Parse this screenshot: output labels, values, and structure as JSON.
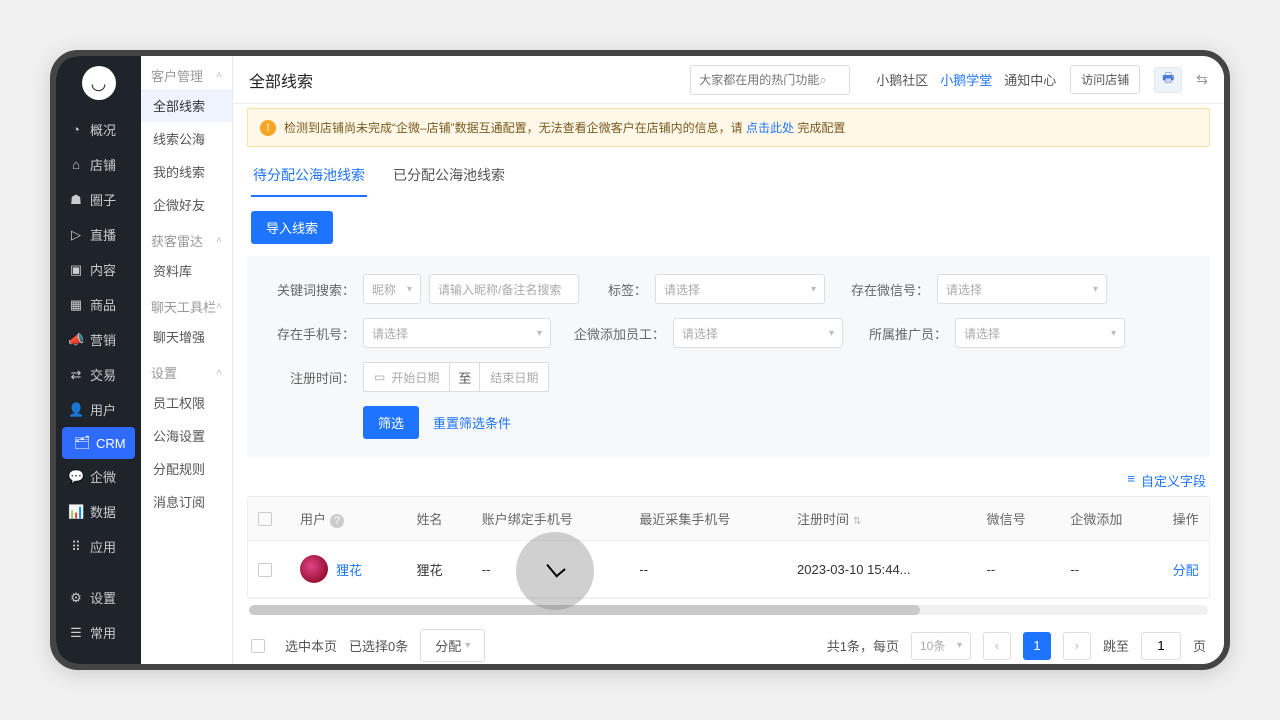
{
  "nav": {
    "items": [
      {
        "icon": "◔",
        "label": "概况"
      },
      {
        "icon": "⌂",
        "label": "店铺"
      },
      {
        "icon": "☗",
        "label": "圈子"
      },
      {
        "icon": "▷",
        "label": "直播"
      },
      {
        "icon": "▣",
        "label": "内容"
      },
      {
        "icon": "▦",
        "label": "商品"
      },
      {
        "icon": "📣",
        "label": "营销"
      },
      {
        "icon": "⇄",
        "label": "交易"
      },
      {
        "icon": "👤",
        "label": "用户"
      },
      {
        "icon": "🗂",
        "label": "CRM"
      },
      {
        "icon": "💬",
        "label": "企微"
      },
      {
        "icon": "📊",
        "label": "数据"
      },
      {
        "icon": "⠿",
        "label": "应用"
      }
    ],
    "footer": [
      {
        "icon": "⚙",
        "label": "设置"
      },
      {
        "icon": "☰",
        "label": "常用"
      }
    ]
  },
  "sec": {
    "groups": [
      {
        "title": "客户管理",
        "items": [
          "全部线索",
          "线索公海",
          "我的线索",
          "企微好友"
        ],
        "active": 0
      },
      {
        "title": "获客雷达",
        "items": [
          "资料库"
        ]
      },
      {
        "title": "聊天工具栏",
        "items": [
          "聊天增强"
        ]
      },
      {
        "title": "设置",
        "items": [
          "员工权限",
          "公海设置",
          "分配规则",
          "消息订阅"
        ]
      }
    ]
  },
  "top": {
    "title": "全部线索",
    "search_ph": "大家都在用的热门功能",
    "links": [
      "小鹅社区",
      "小鹅学堂",
      "通知中心"
    ],
    "active_link": 1,
    "visit": "访问店铺"
  },
  "alert": {
    "pre": "检测到店铺尚未完成“企微–店铺”数据互通配置，无法查看企微客户在店铺内的信息，请 ",
    "link": "点击此处",
    "post": " 完成配置"
  },
  "tabs": [
    "待分配公海池线索",
    "已分配公海池线索"
  ],
  "import_btn": "导入线索",
  "filter": {
    "keyword_lab": "关键词搜索：",
    "nick": "昵称",
    "nick_ph": "请输入昵称/备注名搜索",
    "tag_lab": "标签：",
    "tag_ph": "请选择",
    "wx_lab": "存在微信号：",
    "wx_ph": "请选择",
    "phone_lab": "存在手机号：",
    "phone_ph": "请选择",
    "adder_lab": "企微添加员工：",
    "adder_ph": "请选择",
    "promo_lab": "所属推广员：",
    "promo_ph": "请选择",
    "reg_lab": "注册时间：",
    "start_ph": "开始日期",
    "to": "至",
    "end_ph": "结束日期",
    "filter_btn": "筛选",
    "reset": "重置筛选条件"
  },
  "custom": "自定义字段",
  "table": {
    "cols": [
      "用户",
      "姓名",
      "账户绑定手机号",
      "最近采集手机号",
      "注册时间",
      "微信号",
      "企微添加",
      "操作"
    ],
    "rows": [
      {
        "user": "狸花",
        "name": "狸花",
        "phone": "--",
        "recent": "--",
        "reg": "2023-03-10 15:44...",
        "wx": "--",
        "add": "--",
        "op": "分配"
      }
    ]
  },
  "footer": {
    "select_page": "选中本页",
    "selected": "已选择0条",
    "bulk": "分配",
    "total": "共1条，每页",
    "pagesize": "10条",
    "page": "1",
    "jump_pre": "跳至",
    "jump_val": "1",
    "jump_suf": "页"
  }
}
